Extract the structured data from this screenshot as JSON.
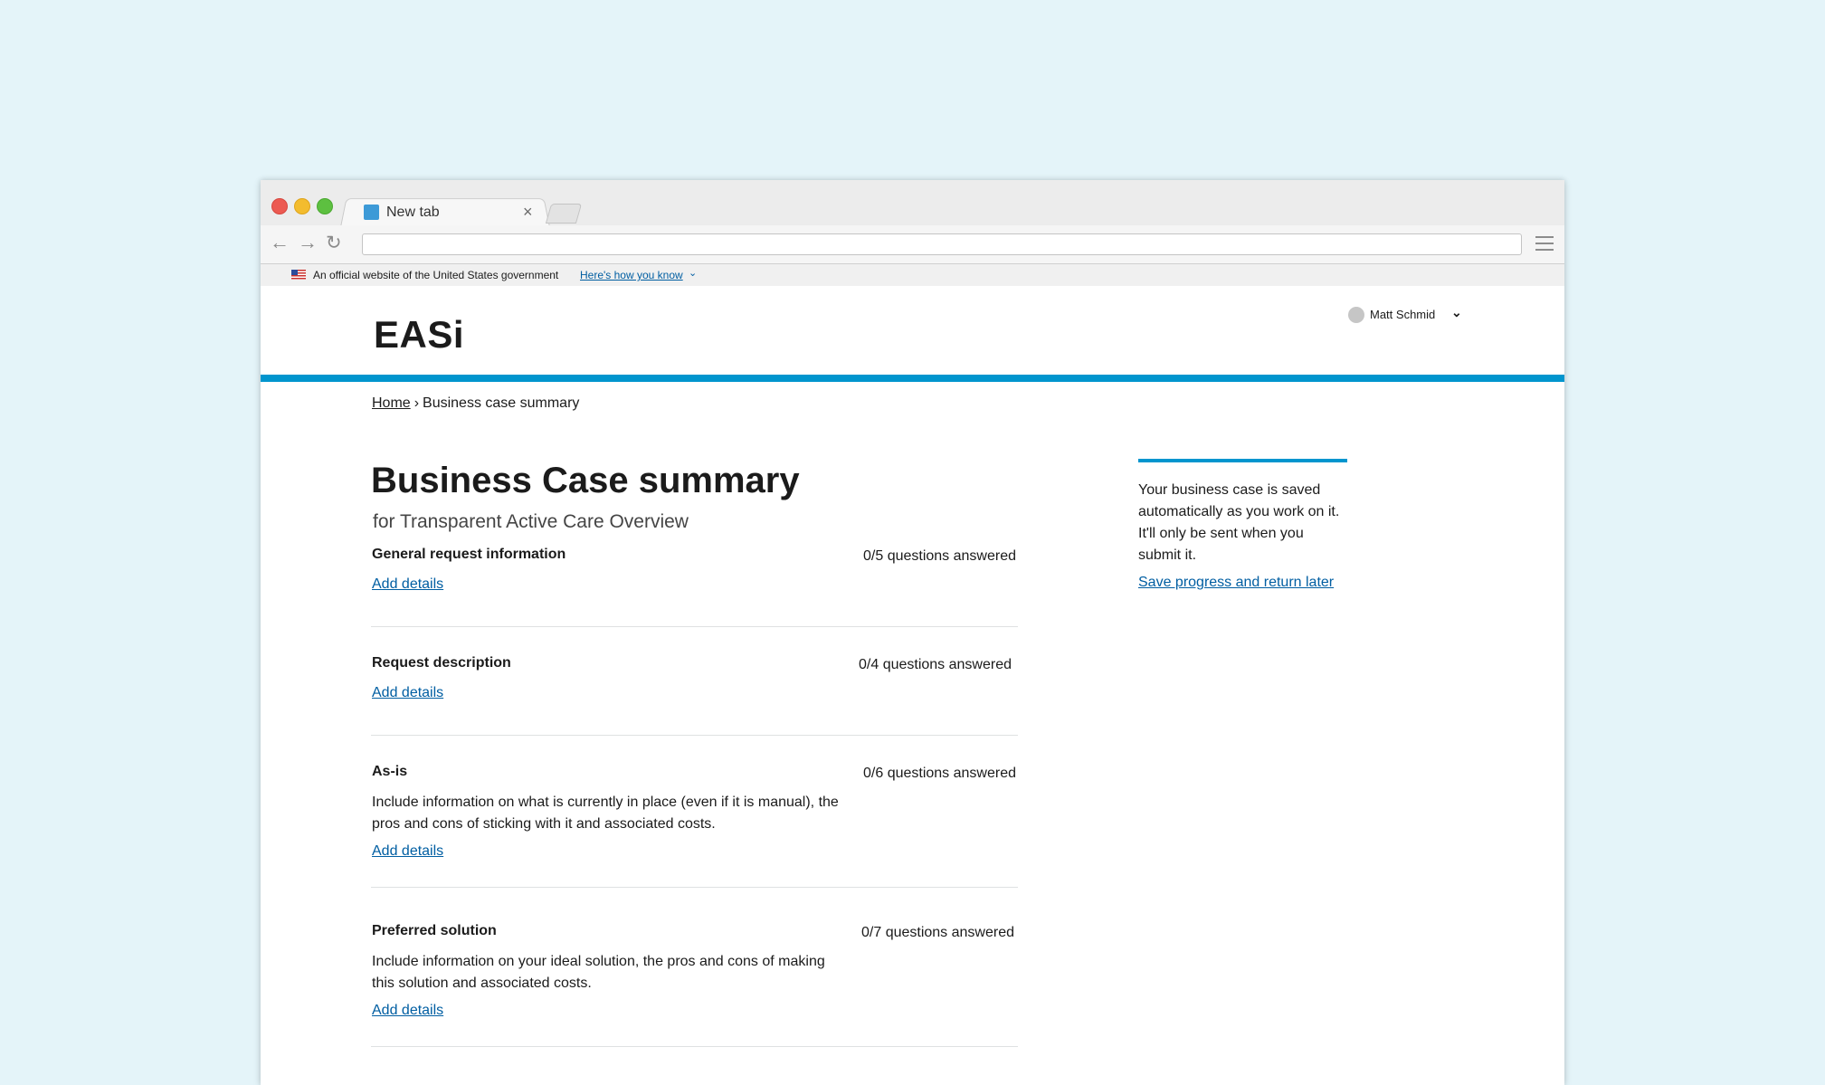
{
  "browser": {
    "tab_title": "New tab",
    "tab_close": "×",
    "address": ""
  },
  "gov_banner": {
    "text": "An official website of the United States government",
    "link": "Here's how you know"
  },
  "header": {
    "logo": "EASi",
    "user_name": "Matt Schmid"
  },
  "breadcrumb": {
    "home": "Home",
    "separator": "›",
    "current": "Business case summary"
  },
  "main": {
    "title": "Business Case summary",
    "subtitle": "for Transparent Active Care Overview",
    "sections": [
      {
        "title": "General request information",
        "count": "0/5 questions answered",
        "description": "",
        "link": "Add details"
      },
      {
        "title": "Request description",
        "count": "0/4 questions answered",
        "description": "",
        "link": "Add details"
      },
      {
        "title": "As-is",
        "count": "0/6 questions answered",
        "description": "Include information on what is currently in place (even if it is manual), the pros and cons of sticking with it and associated costs.",
        "link": "Add details"
      },
      {
        "title": "Preferred solution",
        "count": "0/7 questions answered",
        "description": "Include information on your ideal solution, the pros and cons of making this solution and associated costs.",
        "link": "Add details"
      }
    ]
  },
  "sidebar": {
    "text": "Your business case is saved automatically as you work on it. It'll only be sent when you submit it.",
    "link": "Save progress and return later"
  },
  "colors": {
    "background": "#e4f4f9",
    "accent": "#0095ce",
    "link": "#005ea2"
  },
  "icons": {
    "back": "arrow-left-icon",
    "forward": "arrow-right-icon",
    "reload": "reload-icon",
    "menu": "hamburger-menu-icon",
    "flag": "us-flag-icon",
    "user_chevron": "chevron-down-icon"
  }
}
